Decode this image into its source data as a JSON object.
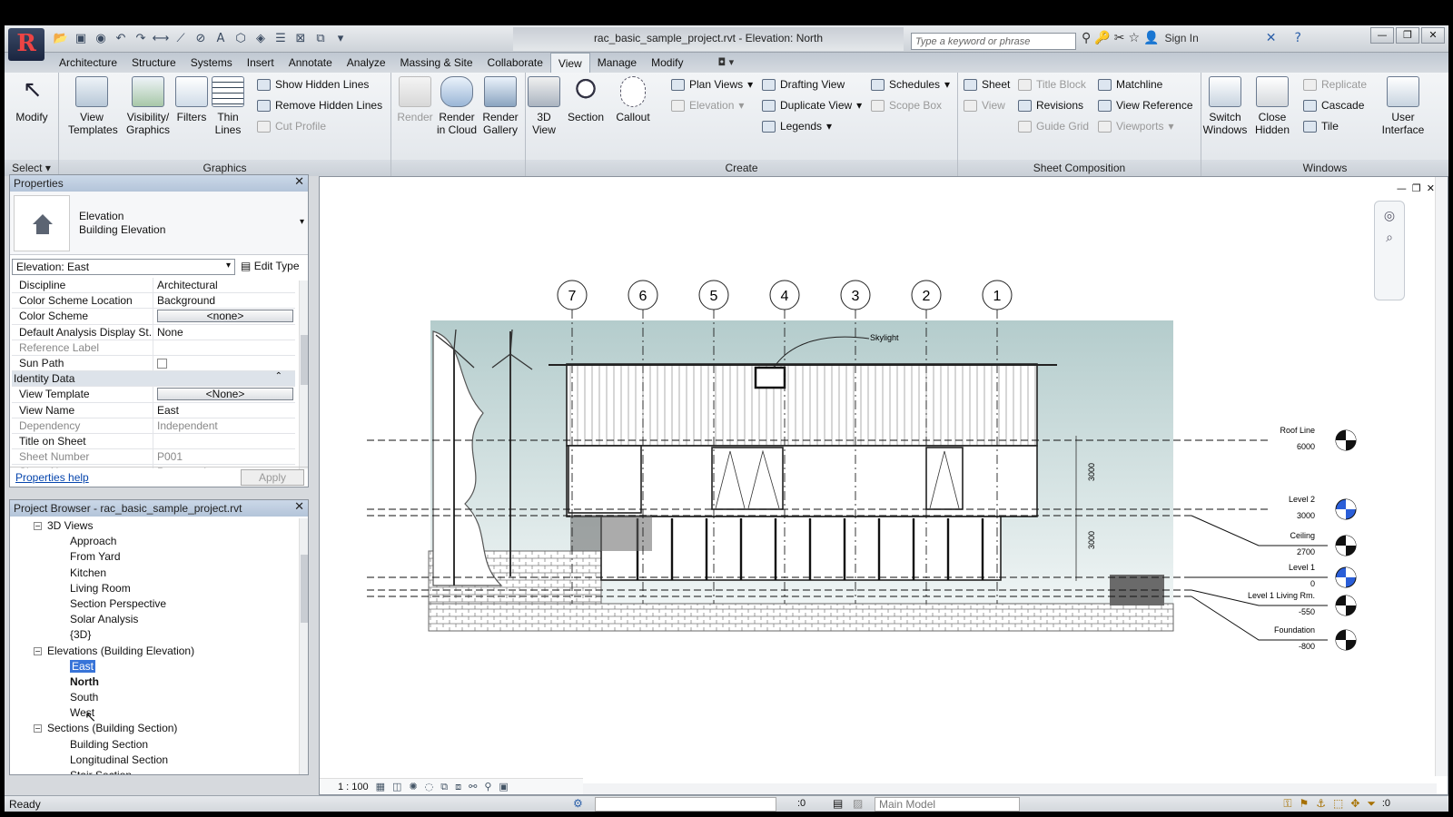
{
  "app": {
    "title": "rac_basic_sample_project.rvt - Elevation: North",
    "search_placeholder": "Type a keyword or phrase",
    "sign_in": "Sign In"
  },
  "tabs": [
    "Architecture",
    "Structure",
    "Systems",
    "Insert",
    "Annotate",
    "Analyze",
    "Massing & Site",
    "Collaborate",
    "View",
    "Manage",
    "Modify"
  ],
  "active_tab": "View",
  "ribbon": {
    "select": {
      "modify": "Modify",
      "panel": "Select"
    },
    "graphics": {
      "panel": "Graphics",
      "view_templates": "View\nTemplates",
      "visibility": "Visibility/\nGraphics",
      "filters": "Filters",
      "thin_lines": "Thin\nLines",
      "show_hidden": "Show  Hidden Lines",
      "remove_hidden": "Remove  Hidden Lines",
      "cut_profile": "Cut  Profile"
    },
    "presentation": {
      "render": "Render",
      "render_cloud": "Render\nin Cloud",
      "render_gallery": "Render\nGallery"
    },
    "create": {
      "panel": "Create",
      "view3d": "3D\nView",
      "section": "Section",
      "callout": "Callout",
      "plan_views": "Plan  Views",
      "elevation": "Elevation",
      "drafting": "Drafting  View",
      "duplicate": "Duplicate  View",
      "legends": "Legends",
      "schedules": "Schedules",
      "scope_box": "Scope  Box"
    },
    "sheet": {
      "panel": "Sheet Composition",
      "sheet": "Sheet",
      "view": "View",
      "title_block": "Title  Block",
      "revisions": "Revisions",
      "guide_grid": "Guide  Grid",
      "matchline": "Matchline",
      "view_reference": "View  Reference",
      "viewports": "Viewports"
    },
    "windows": {
      "panel": "Windows",
      "switch": "Switch\nWindows",
      "close_hidden": "Close\nHidden",
      "replicate": "Replicate",
      "cascade": "Cascade",
      "tile": "Tile",
      "user_interface": "User\nInterface"
    }
  },
  "properties": {
    "title": "Properties",
    "type_name_1": "Elevation",
    "type_name_2": "Building Elevation",
    "view_select": "Elevation: East",
    "edit_type": "Edit Type",
    "rows": [
      {
        "k": "Discipline",
        "v": "Architectural"
      },
      {
        "k": "Color Scheme Location",
        "v": "Background"
      },
      {
        "k": "Color Scheme",
        "v": "<none>"
      },
      {
        "k": "Default Analysis Display St...",
        "v": "None"
      },
      {
        "k": "Reference Label",
        "v": ""
      },
      {
        "k": "Sun Path",
        "v": ""
      },
      {
        "k": "Identity Data",
        "v": ""
      },
      {
        "k": "View Template",
        "v": "<None>"
      },
      {
        "k": "View Name",
        "v": "East"
      },
      {
        "k": "Dependency",
        "v": "Independent"
      },
      {
        "k": "Title on Sheet",
        "v": ""
      },
      {
        "k": "Sheet Number",
        "v": "P001"
      },
      {
        "k": "Sheet Name",
        "v": "Presentation"
      }
    ],
    "help": "Properties help",
    "apply": "Apply"
  },
  "browser": {
    "title": "Project Browser - rac_basic_sample_project.rvt",
    "nodes": [
      {
        "label": "3D Views",
        "level": 1
      },
      {
        "label": "Approach",
        "level": 2
      },
      {
        "label": "From Yard",
        "level": 2
      },
      {
        "label": "Kitchen",
        "level": 2
      },
      {
        "label": "Living Room",
        "level": 2
      },
      {
        "label": "Section Perspective",
        "level": 2
      },
      {
        "label": "Solar Analysis",
        "level": 2
      },
      {
        "label": "{3D}",
        "level": 2
      },
      {
        "label": "Elevations (Building Elevation)",
        "level": 1
      },
      {
        "label": "East",
        "level": 2
      },
      {
        "label": "North",
        "level": 2
      },
      {
        "label": "South",
        "level": 2
      },
      {
        "label": "West",
        "level": 2
      },
      {
        "label": "Sections (Building Section)",
        "level": 1
      },
      {
        "label": "Building Section",
        "level": 2
      },
      {
        "label": "Longitudinal Section",
        "level": 2
      },
      {
        "label": "Stair Section",
        "level": 2
      }
    ]
  },
  "drawing": {
    "grids": [
      "7",
      "6",
      "5",
      "4",
      "3",
      "2",
      "1"
    ],
    "skylight": "Skylight",
    "dim1": "3000",
    "dim2": "3000",
    "levels": [
      {
        "name": "Roof Line",
        "value": "6000"
      },
      {
        "name": "Level 2",
        "value": "3000"
      },
      {
        "name": "Ceiling",
        "value": "2700"
      },
      {
        "name": "Level 1",
        "value": "0"
      },
      {
        "name": "Level 1 Living Rm.",
        "value": "-550"
      },
      {
        "name": "Foundation",
        "value": "-800"
      }
    ],
    "scale": "1 : 100"
  },
  "status": {
    "text": "Ready",
    "selection_count": ":0",
    "model": "Main Model",
    "filter_count": ":0"
  }
}
